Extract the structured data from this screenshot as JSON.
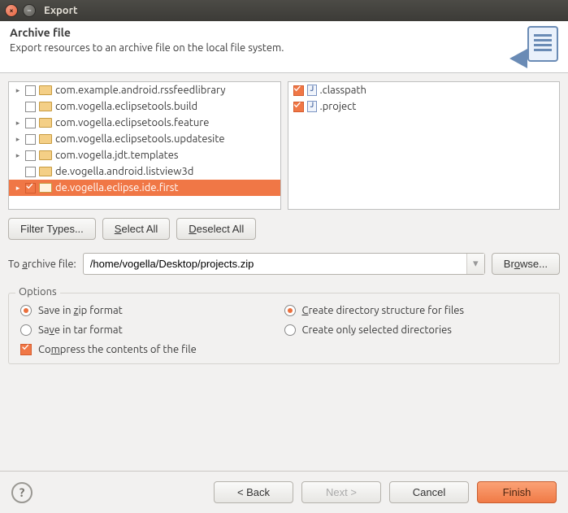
{
  "window": {
    "title": "Export"
  },
  "banner": {
    "heading": "Archive file",
    "subtitle": "Export resources to an archive file on the local file system."
  },
  "tree": {
    "items": [
      {
        "label": "com.example.android.rssfeedlibrary",
        "expandable": true,
        "checked": false
      },
      {
        "label": "com.vogella.eclipsetools.build",
        "expandable": false,
        "checked": false
      },
      {
        "label": "com.vogella.eclipsetools.feature",
        "expandable": true,
        "checked": false
      },
      {
        "label": "com.vogella.eclipsetools.updatesite",
        "expandable": true,
        "checked": false
      },
      {
        "label": "com.vogella.jdt.templates",
        "expandable": true,
        "checked": false
      },
      {
        "label": "de.vogella.android.listview3d",
        "expandable": false,
        "checked": false
      },
      {
        "label": "de.vogella.eclipse.ide.first",
        "expandable": true,
        "checked": true,
        "selected": true
      }
    ]
  },
  "files": {
    "items": [
      {
        "label": ".classpath",
        "checked": true
      },
      {
        "label": ".project",
        "checked": true
      }
    ]
  },
  "buttons": {
    "filter": "Filter Types...",
    "selectAll_pre": "",
    "selectAll_mn": "S",
    "selectAll_post": "elect All",
    "deselectAll_pre": "",
    "deselectAll_mn": "D",
    "deselectAll_post": "eselect All"
  },
  "archive": {
    "label_pre": "To ",
    "label_mn": "a",
    "label_post": "rchive file:",
    "value": "/home/vogella/Desktop/projects.zip",
    "browse_pre": "Br",
    "browse_mn": "o",
    "browse_post": "wse..."
  },
  "options": {
    "legend": "Options",
    "zip_pre": "Save in ",
    "zip_mn": "z",
    "zip_post": "ip format",
    "tar_pre": "Sa",
    "tar_mn": "v",
    "tar_post": "e in tar format",
    "createdir_mn": "C",
    "createdir_post": "reate directory structure for files",
    "onlysel": "Create only selected directories",
    "compress_pre": "Co",
    "compress_mn": "m",
    "compress_post": "press the contents of the file",
    "zip_on": true,
    "tar_on": false,
    "createdir_on": true,
    "onlysel_on": false,
    "compress_on": true
  },
  "footer": {
    "back": "< Back",
    "next": "Next >",
    "cancel": "Cancel",
    "finish": "Finish"
  }
}
